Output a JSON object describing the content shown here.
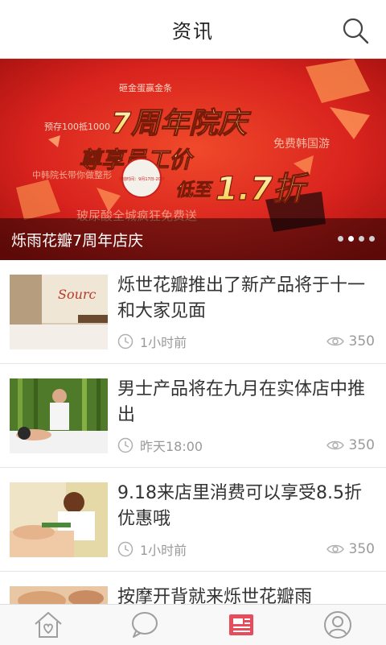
{
  "header": {
    "title": "资讯"
  },
  "banner": {
    "caption": "烁雨花瓣7周年店庆",
    "slide_count": 4,
    "active_slide": 1,
    "artwork": {
      "headline": "7周年院庆",
      "subhead": "尊享员工价",
      "low_price": "低至",
      "discount": "1.7折",
      "promo_top": "砸金蛋赢金条",
      "promo_left1": "预存100抵1000",
      "promo_left2": "中韩院长带你做整形",
      "promo_right": "免费韩国游",
      "promo_bottom": "玻尿酸全城疯狂免费送",
      "date_badge": "活动时间：9月17日-20日"
    }
  },
  "news": [
    {
      "title": "烁世花瓣推出了新产品将于十一和大家见面",
      "time": "1小时前",
      "views": "350",
      "thumb": "salon-reception"
    },
    {
      "title": "男士产品将在九月在实体店中推出",
      "time": "昨天18:00",
      "views": "350",
      "thumb": "bamboo-massage"
    },
    {
      "title": "9.18来店里消费可以享受8.5折优惠哦",
      "time": "1小时前",
      "views": "350",
      "thumb": "spa-treatment"
    },
    {
      "title": "按摩开背就来烁世花瓣雨",
      "time": "",
      "views": "",
      "thumb": "hand-massage"
    }
  ],
  "tabbar": {
    "items": [
      {
        "name": "home",
        "icon": "house-heart-icon",
        "active": false
      },
      {
        "name": "chat",
        "icon": "speech-bubble-icon",
        "active": false
      },
      {
        "name": "news",
        "icon": "newspaper-icon",
        "active": true
      },
      {
        "name": "profile",
        "icon": "user-icon",
        "active": false
      }
    ]
  },
  "colors": {
    "accent": "#e84c5a",
    "banner_red": "#d9231e",
    "text": "#333333",
    "muted": "#9a9a9a",
    "tab_icon": "#9e9e9e"
  }
}
